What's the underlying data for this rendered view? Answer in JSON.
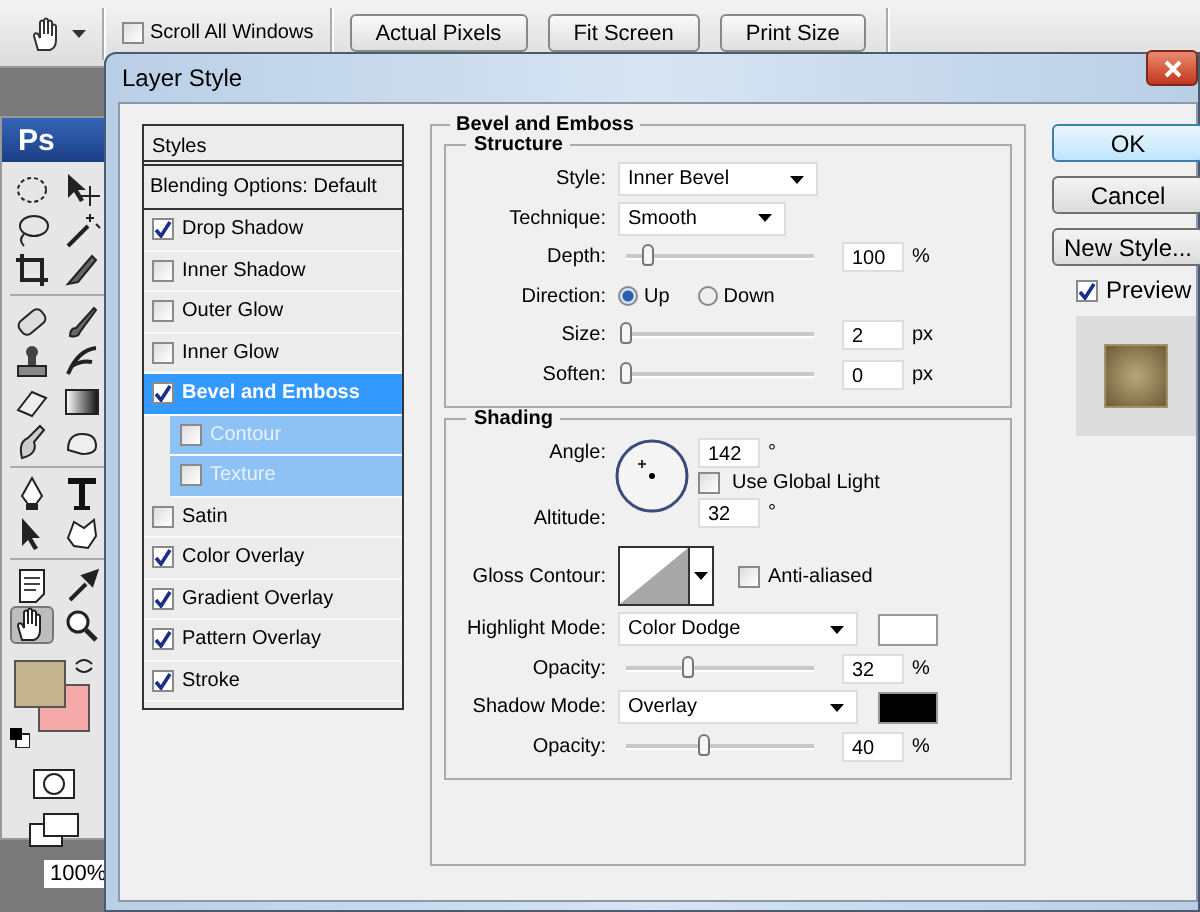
{
  "options_bar": {
    "scroll_all_windows": {
      "label": "Scroll All Windows",
      "checked": false
    },
    "buttons": [
      "Actual Pixels",
      "Fit Screen",
      "Print Size"
    ]
  },
  "toolbox": {
    "logo": "Ps",
    "zoom_level": "100%"
  },
  "dialog": {
    "title": "Layer Style",
    "styles_header": "Styles",
    "blending_options": "Blending Options: Default",
    "effects": [
      {
        "label": "Drop Shadow",
        "checked": true,
        "selected": false
      },
      {
        "label": "Inner Shadow",
        "checked": false,
        "selected": false
      },
      {
        "label": "Outer Glow",
        "checked": false,
        "selected": false
      },
      {
        "label": "Inner Glow",
        "checked": false,
        "selected": false
      },
      {
        "label": "Bevel and Emboss",
        "checked": true,
        "selected": true,
        "children": [
          {
            "label": "Contour",
            "checked": false,
            "selected": false
          },
          {
            "label": "Texture",
            "checked": false,
            "selected": false
          }
        ]
      },
      {
        "label": "Satin",
        "checked": false,
        "selected": false
      },
      {
        "label": "Color Overlay",
        "checked": true,
        "selected": false
      },
      {
        "label": "Gradient Overlay",
        "checked": true,
        "selected": false
      },
      {
        "label": "Pattern Overlay",
        "checked": true,
        "selected": false
      },
      {
        "label": "Stroke",
        "checked": true,
        "selected": false
      }
    ],
    "bevel_and_emboss": {
      "title": "Bevel and Emboss",
      "structure": {
        "title": "Structure",
        "style": {
          "label": "Style:",
          "value": "Inner Bevel"
        },
        "technique": {
          "label": "Technique:",
          "value": "Smooth"
        },
        "depth": {
          "label": "Depth:",
          "level": 0.12,
          "value": "100",
          "unit": "%"
        },
        "direction": {
          "label": "Direction:",
          "options": [
            {
              "label": "Up",
              "selected": true
            },
            {
              "label": "Down",
              "selected": false
            }
          ]
        },
        "size": {
          "label": "Size:",
          "level": 0.0,
          "value": "2",
          "unit": "px"
        },
        "soften": {
          "label": "Soften:",
          "level": 0.0,
          "value": "0",
          "unit": "px"
        }
      },
      "shading": {
        "title": "Shading",
        "angle": {
          "label": "Angle:",
          "value": "142",
          "unit": "°"
        },
        "use_global_light": {
          "label": "Use Global Light",
          "checked": false
        },
        "altitude": {
          "label": "Altitude:",
          "value": "32",
          "unit": "°"
        },
        "gloss_contour": {
          "label": "Gloss Contour:"
        },
        "anti_aliased": {
          "label": "Anti-aliased",
          "checked": false
        },
        "highlight_mode": {
          "label": "Highlight Mode:",
          "value": "Color Dodge"
        },
        "highlight_opacity": {
          "label": "Opacity:",
          "level": 0.33,
          "value": "32",
          "unit": "%"
        },
        "shadow_mode": {
          "label": "Shadow Mode:",
          "value": "Overlay"
        },
        "shadow_opacity": {
          "label": "Opacity:",
          "level": 0.41,
          "value": "40",
          "unit": "%"
        }
      }
    },
    "buttons": [
      {
        "label": "OK",
        "default": true
      },
      {
        "label": "Cancel",
        "default": false
      },
      {
        "label": "New Style...",
        "default": false
      }
    ],
    "preview": {
      "label": "Preview",
      "checked": true
    }
  }
}
